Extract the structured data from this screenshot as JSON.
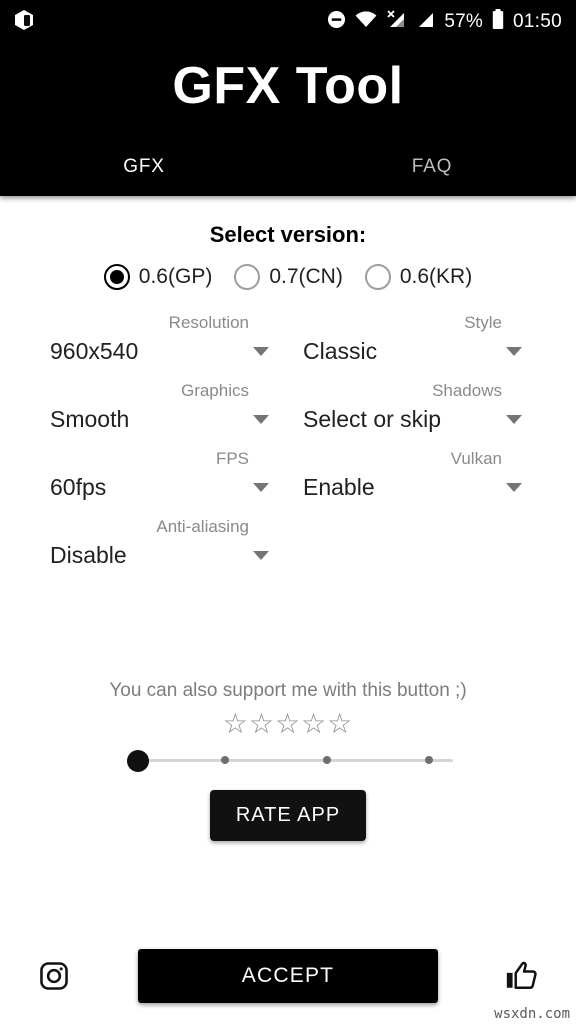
{
  "statusbar": {
    "app_icon": "cube-app-icon",
    "icons": [
      "dnd-icon",
      "wifi-icon",
      "signal-no-sim-icon",
      "signal-icon"
    ],
    "battery_percent": "57%",
    "battery_icon": "battery-icon",
    "clock": "01:50"
  },
  "header": {
    "title": "GFX Tool",
    "tabs": [
      {
        "label": "GFX",
        "active": true
      },
      {
        "label": "FAQ",
        "active": false
      }
    ]
  },
  "main": {
    "select_version_label": "Select version:",
    "versions": [
      {
        "label": "0.6(GP)",
        "selected": true
      },
      {
        "label": "0.7(CN)",
        "selected": false
      },
      {
        "label": "0.6(KR)",
        "selected": false
      }
    ],
    "settings": [
      {
        "label": "Resolution",
        "value": "960x540",
        "caret": "chevron-down-icon"
      },
      {
        "label": "Style",
        "value": "Classic",
        "caret": "chevron-down-icon"
      },
      {
        "label": "Graphics",
        "value": "Smooth",
        "caret": "chevron-down-icon"
      },
      {
        "label": "Shadows",
        "value": "Select or skip",
        "caret": "chevron-down-icon"
      },
      {
        "label": "FPS",
        "value": "60fps",
        "caret": "chevron-down-icon"
      },
      {
        "label": "Vulkan",
        "value": "Enable",
        "caret": "chevron-down-icon"
      },
      {
        "label": "Anti-aliasing",
        "value": "Disable",
        "caret": "chevron-down-icon"
      }
    ],
    "support": {
      "text": "You can also support me with this button ;)",
      "stars": "☆☆☆☆☆",
      "star_count": 5,
      "slider_value": 0,
      "slider_ticks": 4,
      "rate_button": "RATE APP"
    }
  },
  "bottom": {
    "instagram_icon": "instagram-icon",
    "accept_button": "ACCEPT",
    "thumbs_up_icon": "thumbs-up-icon",
    "watermark": "wsxdn.com"
  },
  "colors": {
    "header_bg": "#000000",
    "page_bg": "#ffffff",
    "label_grey": "#8a8a8a",
    "value_black": "#212121",
    "accent_black": "#111111"
  }
}
